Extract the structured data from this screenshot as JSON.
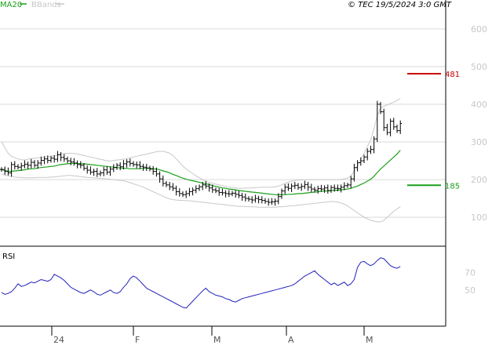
{
  "legend": {
    "ma_label": "MA20",
    "bb_label": "BBands"
  },
  "copyright": "© TEC 19/5/2024 3:0 GMT",
  "colors": {
    "price": "#000000",
    "ma20": "#1aa01a",
    "bbands": "#c8c8c8",
    "rsi": "#2222bb",
    "resistance": "#cc0000",
    "support": "#1aa01a",
    "grid": "#d9d9d9",
    "axis": "#000000"
  },
  "chart_data": [
    {
      "type": "ohlc",
      "title": "",
      "y_ticks": [
        "600",
        "500",
        "400",
        "300",
        "200",
        "100"
      ],
      "ylim": [
        40,
        660
      ],
      "x_ticks": [
        "24",
        "F",
        "M",
        "A",
        "M"
      ],
      "levels": [
        {
          "label": "481",
          "value": 481,
          "color": "#cc0000"
        },
        {
          "label": "185",
          "value": 185,
          "color": "#1aa01a"
        }
      ],
      "close": [
        227,
        222,
        218,
        240,
        235,
        233,
        237,
        241,
        238,
        246,
        238,
        244,
        251,
        255,
        251,
        257,
        254,
        266,
        259,
        255,
        250,
        247,
        244,
        240,
        238,
        230,
        225,
        220,
        222,
        215,
        218,
        226,
        220,
        228,
        232,
        238,
        234,
        242,
        247,
        243,
        240,
        239,
        235,
        233,
        231,
        228,
        222,
        215,
        202,
        190,
        186,
        181,
        177,
        168,
        163,
        160,
        163,
        168,
        172,
        176,
        181,
        186,
        183,
        178,
        173,
        170,
        166,
        165,
        163,
        162,
        164,
        161,
        158,
        154,
        150,
        148,
        146,
        150,
        147,
        145,
        142,
        140,
        141,
        143,
        155,
        170,
        180,
        177,
        183,
        185,
        179,
        182,
        187,
        180,
        175,
        172,
        176,
        175,
        178,
        171,
        179,
        177,
        176,
        180,
        184,
        186,
        202,
        232,
        245,
        250,
        260,
        275,
        280,
        308,
        400,
        380,
        338,
        325,
        355,
        340,
        330,
        349
      ],
      "ma20": [
        227,
        224,
        222,
        222,
        223,
        224,
        225,
        226,
        228,
        229,
        229,
        231,
        232,
        233,
        234,
        235,
        236,
        238,
        240,
        241,
        242,
        243,
        243,
        243,
        242,
        242,
        241,
        240,
        239,
        238,
        237,
        236,
        235,
        234,
        233,
        232,
        231,
        230,
        230,
        229,
        229,
        229,
        229,
        230,
        230,
        230,
        229,
        228,
        226,
        223,
        221,
        218,
        214,
        211,
        207,
        204,
        201,
        199,
        197,
        195,
        193,
        191,
        189,
        187,
        184,
        182,
        180,
        178,
        177,
        175,
        174,
        173,
        171,
        170,
        169,
        168,
        167,
        166,
        165,
        164,
        163,
        162,
        161,
        160,
        160,
        160,
        160,
        161,
        161,
        162,
        163,
        163,
        164,
        165,
        166,
        167,
        168,
        169,
        170,
        170,
        171,
        172,
        172,
        173,
        174,
        175,
        177,
        180,
        183,
        187,
        191,
        196,
        201,
        209,
        219,
        228,
        236,
        244,
        252,
        260,
        268,
        278
      ],
      "bb_upper": [
        300,
        285,
        270,
        262,
        258,
        255,
        253,
        252,
        254,
        256,
        257,
        258,
        259,
        260,
        261,
        262,
        263,
        266,
        268,
        269,
        270,
        270,
        269,
        268,
        266,
        264,
        262,
        260,
        258,
        256,
        254,
        252,
        250,
        250,
        251,
        252,
        253,
        254,
        256,
        258,
        260,
        262,
        264,
        266,
        268,
        270,
        272,
        274,
        275,
        275,
        273,
        270,
        264,
        255,
        246,
        236,
        228,
        222,
        216,
        210,
        205,
        200,
        196,
        193,
        190,
        188,
        186,
        184,
        182,
        180,
        178,
        178,
        177,
        177,
        178,
        178,
        178,
        179,
        179,
        180,
        180,
        180,
        180,
        181,
        183,
        186,
        190,
        193,
        196,
        198,
        199,
        199,
        200,
        200,
        200,
        200,
        200,
        200,
        200,
        200,
        200,
        200,
        200,
        201,
        202,
        204,
        210,
        222,
        236,
        254,
        270,
        288,
        305,
        335,
        370,
        390,
        395,
        398,
        402,
        406,
        410,
        415
      ],
      "bb_lower": [
        215,
        212,
        210,
        208,
        207,
        206,
        206,
        205,
        205,
        205,
        205,
        206,
        206,
        206,
        206,
        207,
        207,
        208,
        209,
        210,
        211,
        211,
        210,
        209,
        208,
        207,
        206,
        205,
        205,
        204,
        204,
        203,
        202,
        201,
        200,
        199,
        198,
        197,
        195,
        192,
        189,
        186,
        183,
        180,
        176,
        172,
        168,
        164,
        160,
        156,
        152,
        149,
        147,
        146,
        145,
        145,
        144,
        144,
        143,
        142,
        141,
        140,
        139,
        138,
        137,
        136,
        135,
        134,
        133,
        132,
        131,
        130,
        129,
        129,
        129,
        128,
        128,
        128,
        127,
        127,
        127,
        127,
        127,
        127,
        128,
        128,
        129,
        130,
        131,
        131,
        132,
        133,
        134,
        135,
        136,
        137,
        138,
        139,
        140,
        141,
        142,
        142,
        140,
        138,
        135,
        130,
        124,
        118,
        112,
        106,
        100,
        96,
        92,
        90,
        88,
        88,
        92,
        100,
        108,
        116,
        122,
        128
      ]
    },
    {
      "type": "line",
      "title": "RSI",
      "y_ticks": [
        "70",
        "50"
      ],
      "ylim": [
        10,
        95
      ],
      "values": [
        47,
        45,
        46,
        48,
        52,
        57,
        54,
        55,
        57,
        59,
        58,
        60,
        62,
        61,
        60,
        62,
        68,
        66,
        64,
        61,
        57,
        53,
        51,
        49,
        47,
        46,
        48,
        50,
        48,
        45,
        44,
        46,
        48,
        50,
        47,
        46,
        48,
        53,
        57,
        63,
        66,
        64,
        60,
        56,
        52,
        50,
        48,
        46,
        44,
        42,
        40,
        38,
        36,
        34,
        32,
        30,
        29,
        33,
        37,
        41,
        45,
        49,
        52,
        48,
        46,
        44,
        43,
        42,
        40,
        39,
        37,
        36,
        38,
        40,
        41,
        42,
        43,
        44,
        45,
        46,
        47,
        48,
        49,
        50,
        51,
        52,
        53,
        54,
        55,
        57,
        60,
        63,
        66,
        68,
        70,
        72,
        68,
        65,
        62,
        59,
        56,
        58,
        55,
        57,
        59,
        55,
        57,
        62,
        76,
        82,
        83,
        80,
        78,
        80,
        84,
        87,
        86,
        82,
        78,
        76,
        75,
        77
      ]
    }
  ]
}
